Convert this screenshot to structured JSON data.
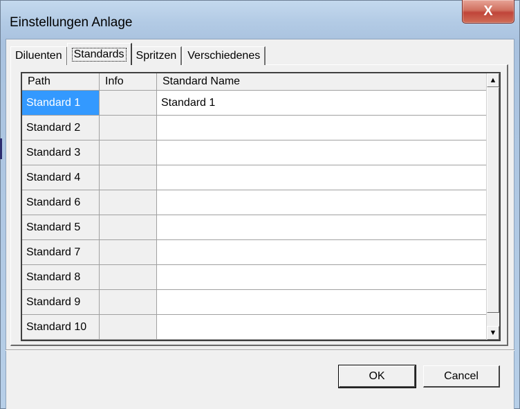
{
  "window": {
    "title": "Einstellungen Anlage",
    "close_glyph": "X"
  },
  "tabs": [
    {
      "label": "Diluenten",
      "active": false
    },
    {
      "label": "Standards",
      "active": true
    },
    {
      "label": "Spritzen",
      "active": false
    },
    {
      "label": "Verschiedenes",
      "active": false
    }
  ],
  "grid": {
    "columns": [
      "Path",
      "Info",
      "Standard Name"
    ],
    "rows": [
      {
        "path": "Standard 1",
        "info": "",
        "name": "Standard 1"
      },
      {
        "path": "Standard 2",
        "info": "",
        "name": ""
      },
      {
        "path": "Standard 3",
        "info": "",
        "name": ""
      },
      {
        "path": "Standard 4",
        "info": "",
        "name": ""
      },
      {
        "path": "Standard 6",
        "info": "",
        "name": ""
      },
      {
        "path": "Standard 5",
        "info": "",
        "name": ""
      },
      {
        "path": "Standard 7",
        "info": "",
        "name": ""
      },
      {
        "path": "Standard 8",
        "info": "",
        "name": ""
      },
      {
        "path": "Standard 9",
        "info": "",
        "name": ""
      },
      {
        "path": "Standard 10",
        "info": "",
        "name": ""
      }
    ],
    "selected_row": 0
  },
  "buttons": {
    "ok": "OK",
    "cancel": "Cancel"
  },
  "colors": {
    "selection": "#3399ff",
    "close_button": "#c0453a"
  }
}
